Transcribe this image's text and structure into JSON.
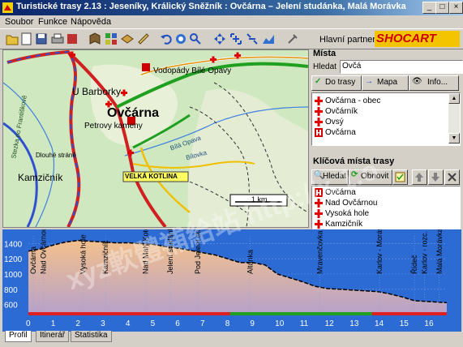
{
  "window": {
    "title": "Turistické trasy 2.13 : Jeseníky, Králický Sněžník : Ovčárna  –  Jelení studánka, Malá Morávka"
  },
  "menu": [
    "Soubor",
    "Funkce",
    "Nápověda"
  ],
  "toolbar": {
    "partner_label": "Hlavní partner",
    "partner_logo": "SHOCART"
  },
  "map": {
    "labels": {
      "u_barborky": "U Barborky",
      "ovcarna": "Ovčárna",
      "petrovy_kameny": "Petrovy kameny",
      "vodopady": "Vodopády Bílé Opavy",
      "kamznicnik": "Kamzičník",
      "velka_kotlina": "VELKÁ KOTLINA",
      "scale": "1 km",
      "stezka": "Stezka po Františkově",
      "bila_opava": "Bílá Opava",
      "bilovka": "Bílovka",
      "kamzicnik2": "Kamzičník",
      "dlouhe": "Dlouhé stráně"
    }
  },
  "places": {
    "title": "Místa",
    "search_label": "Hledat",
    "search_value": "Ovčá",
    "btn_route": "Do trasy",
    "btn_map": "Mapa",
    "btn_info": "Info...",
    "items": [
      "Ovčárna - obec",
      "Ovčárník",
      "Ovsý",
      "Ovčárna"
    ]
  },
  "keypoints": {
    "title": "Klíčová místa trasy",
    "btn_search": "Hledat",
    "btn_refresh": "Obnovit",
    "items": [
      "Ovčárna",
      "Nad Ovčárnou",
      "Vysoká hole",
      "Kamzičník"
    ]
  },
  "profile": {
    "y_ticks": [
      "1400",
      "1200",
      "1000",
      "800",
      "600"
    ],
    "x_ticks": [
      "0",
      "1",
      "2",
      "3",
      "4",
      "5",
      "6",
      "7",
      "8",
      "9",
      "10",
      "11",
      "12",
      "13",
      "14",
      "15",
      "16"
    ],
    "points": [
      "Ovčárna",
      "Nad Ovčárnou",
      "Vysoká hole",
      "Kamzičník",
      "Nad Malý Kotel",
      "Jelení studánka",
      "Pod Jelení studánkou",
      "Altánka",
      "Mravenčovka",
      "Karlov - Morávice",
      "Řídeč",
      "Karlov - rozc.",
      "Malá Morávka - rychta"
    ]
  },
  "tabs": [
    "Profil",
    "Itinerář",
    "Statistika"
  ],
  "watermark": "xyz軟體補給站 http://x.1.o"
}
